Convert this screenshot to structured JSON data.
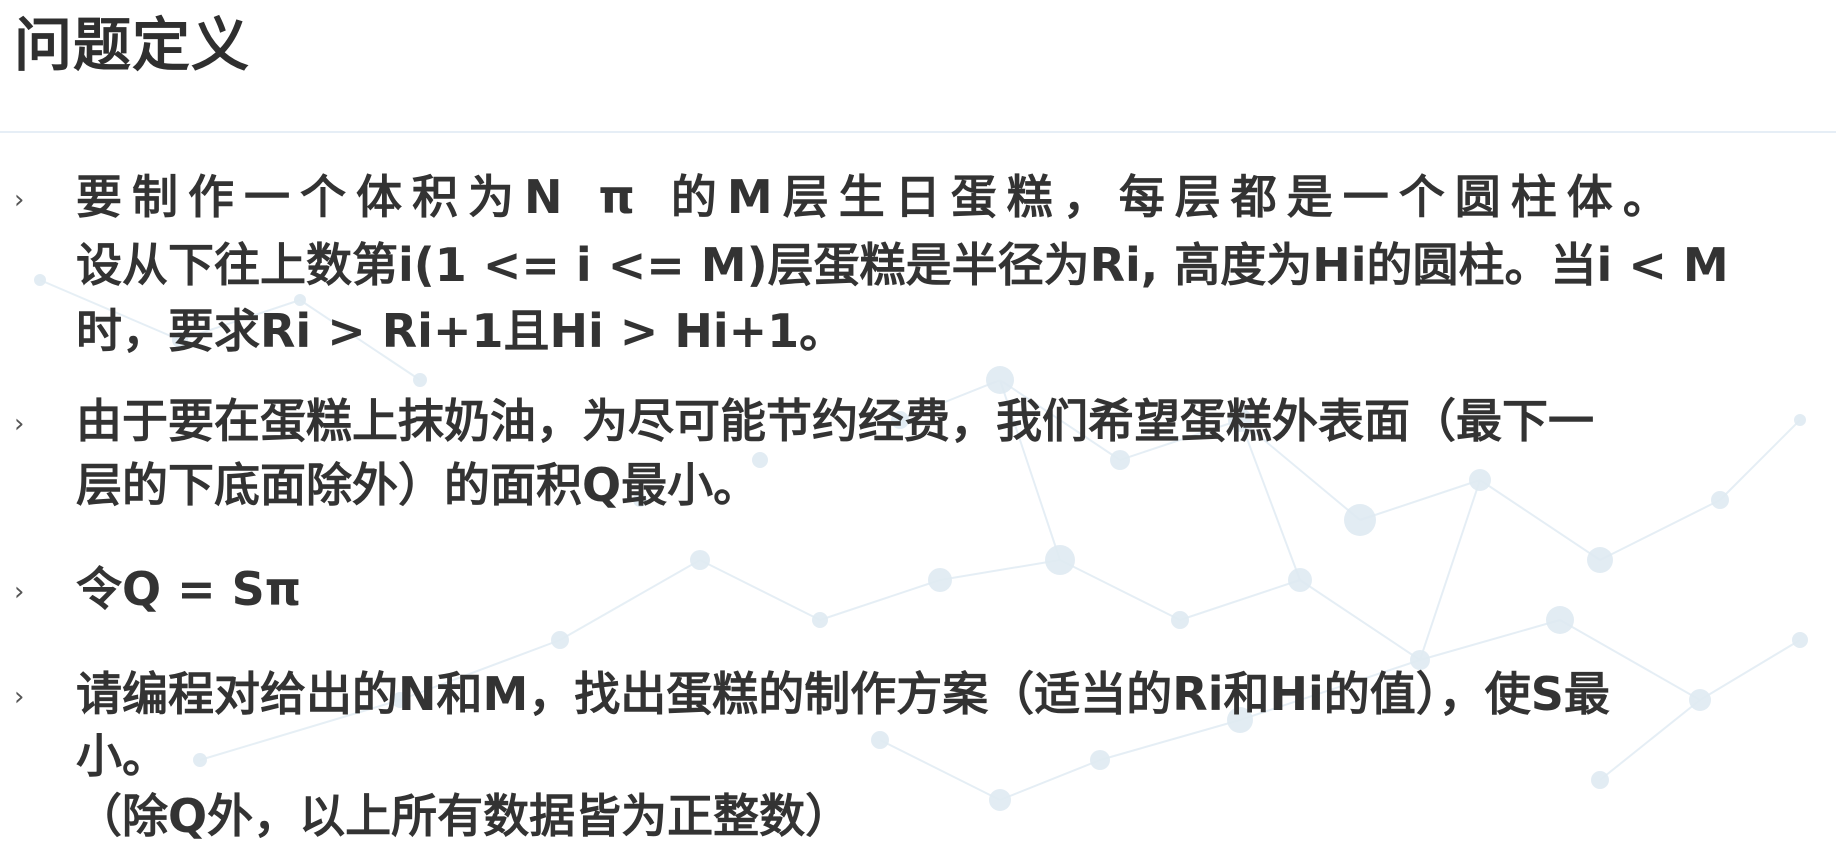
{
  "title": "问题定义",
  "bullets": [
    {
      "marker": "›",
      "lines": [
        "要制作一个体积为N π 的M层生日蛋糕，每层都是一个圆柱体。",
        "设从下往上数第i(1  <= i <= M)层蛋糕是半径为Ri, 高度为Hi的圆柱。当i < M",
        "时，要求Ri > Ri+1且Hi > Hi+1。"
      ]
    },
    {
      "marker": "›",
      "lines": [
        "由于要在蛋糕上抹奶油，为尽可能节约经费，我们希望蛋糕外表面（最下一",
        "层的下底面除外）的面积Q最小。"
      ]
    },
    {
      "marker": "›",
      "lines": [
        "令Q = Sπ"
      ]
    },
    {
      "marker": "›",
      "lines": [
        "请编程对给出的N和M，找出蛋糕的制作方案（适当的Ri和Hi的值），使S最",
        "小。",
        "（除Q外，以上所有数据皆为正整数）"
      ]
    }
  ],
  "colors": {
    "text": "#333333",
    "rule": "#e6eef6",
    "network": "#dce8f1"
  }
}
